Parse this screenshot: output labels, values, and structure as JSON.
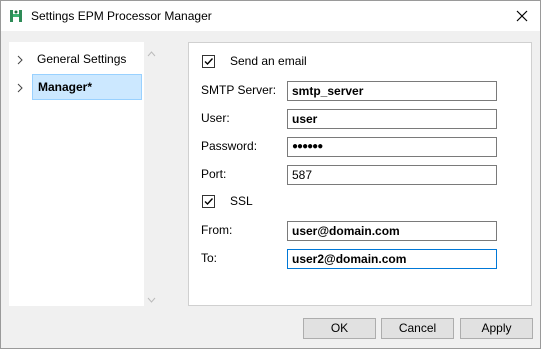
{
  "window": {
    "title": "Settings EPM Processor Manager",
    "icon": "app-icon",
    "close_icon": "close-icon"
  },
  "sidebar": {
    "items": [
      {
        "label": "General Settings",
        "selected": false
      },
      {
        "label": "Manager*",
        "selected": true
      }
    ]
  },
  "form": {
    "send_email": {
      "label": "Send an email",
      "checked": true
    },
    "smtp_server": {
      "label": "SMTP Server:",
      "value": "smtp_server"
    },
    "user": {
      "label": "User:",
      "value": "user"
    },
    "password": {
      "label": "Password:",
      "value": "●●●●●●"
    },
    "port": {
      "label": "Port:",
      "value": "587"
    },
    "ssl": {
      "label": "SSL",
      "checked": true
    },
    "from": {
      "label": "From:",
      "value": "user@domain.com"
    },
    "to": {
      "label": "To:",
      "value": "user2@domain.com"
    }
  },
  "buttons": {
    "ok": "OK",
    "cancel": "Cancel",
    "apply": "Apply"
  },
  "colors": {
    "selection_bg": "#cce8ff",
    "focus_border": "#0078d7"
  }
}
